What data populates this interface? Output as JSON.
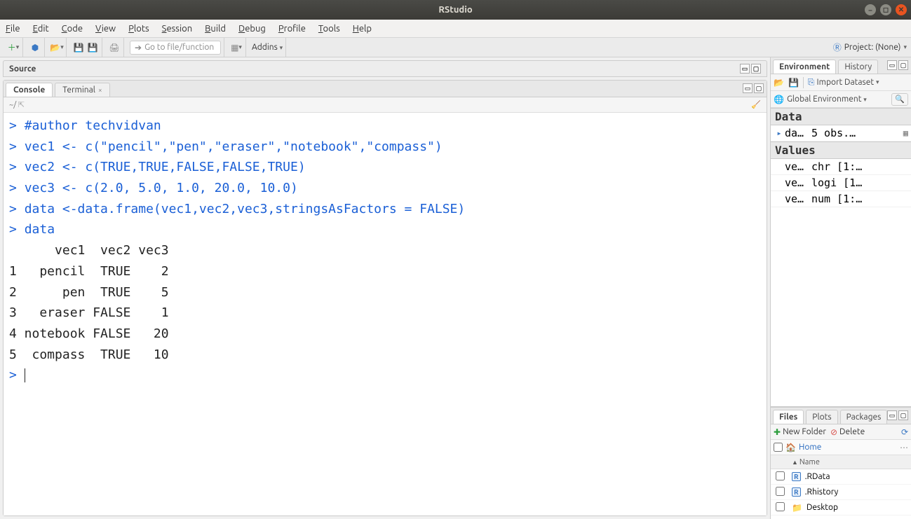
{
  "window": {
    "title": "RStudio"
  },
  "menus": [
    "File",
    "Edit",
    "Code",
    "View",
    "Plots",
    "Session",
    "Build",
    "Debug",
    "Profile",
    "Tools",
    "Help"
  ],
  "toolbar": {
    "goto_placeholder": "Go to file/function",
    "addins_label": "Addins",
    "project_label": "Project: (None)"
  },
  "source_pane": {
    "title": "Source"
  },
  "console": {
    "tabs": [
      "Console",
      "Terminal"
    ],
    "active_tab": 0,
    "cwd": "~/",
    "lines": [
      {
        "type": "cmd",
        "text": "#author techvidvan"
      },
      {
        "type": "cmd",
        "text": "vec1 <- c(\"pencil\",\"pen\",\"eraser\",\"notebook\",\"compass\")"
      },
      {
        "type": "cmd",
        "text": "vec2 <- c(TRUE,TRUE,FALSE,FALSE,TRUE)"
      },
      {
        "type": "cmd",
        "text": "vec3 <- c(2.0, 5.0, 1.0, 20.0, 10.0)"
      },
      {
        "type": "cmd",
        "text": "data <-data.frame(vec1,vec2,vec3,stringsAsFactors = FALSE)"
      },
      {
        "type": "cmd",
        "text": "data"
      },
      {
        "type": "out",
        "text": "      vec1  vec2 vec3"
      },
      {
        "type": "out",
        "text": "1   pencil  TRUE    2"
      },
      {
        "type": "out",
        "text": "2      pen  TRUE    5"
      },
      {
        "type": "out",
        "text": "3   eraser FALSE    1"
      },
      {
        "type": "out",
        "text": "4 notebook FALSE   20"
      },
      {
        "type": "out",
        "text": "5  compass  TRUE   10"
      },
      {
        "type": "prompt",
        "text": ""
      }
    ]
  },
  "environment": {
    "tabs": [
      "Environment",
      "History"
    ],
    "import_label": "Import Dataset",
    "scope_label": "Global Environment",
    "sections": [
      {
        "title": "Data",
        "rows": [
          {
            "icon": "expand",
            "name": "da…",
            "value": "5 obs.…",
            "grid": true
          }
        ]
      },
      {
        "title": "Values",
        "rows": [
          {
            "icon": "",
            "name": "ve…",
            "value": "chr [1:…",
            "grid": false
          },
          {
            "icon": "",
            "name": "ve…",
            "value": "logi [1…",
            "grid": false
          },
          {
            "icon": "",
            "name": "ve…",
            "value": "num [1:…",
            "grid": false
          }
        ]
      }
    ]
  },
  "files_panel": {
    "tabs": [
      "Files",
      "Plots",
      "Packages"
    ],
    "new_folder": "New Folder",
    "delete": "Delete",
    "breadcrumb": "Home",
    "col_name": "Name",
    "rows": [
      {
        "type": "r",
        "name": ".RData"
      },
      {
        "type": "r",
        "name": ".Rhistory"
      },
      {
        "type": "folder",
        "name": "Desktop"
      }
    ]
  }
}
